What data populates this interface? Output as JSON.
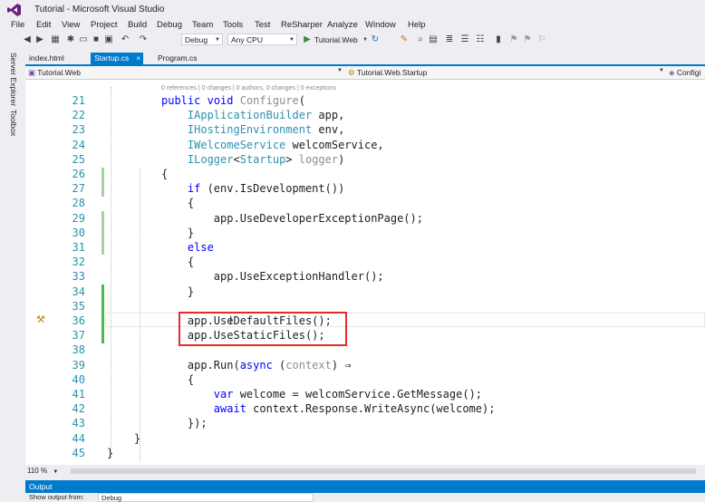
{
  "window": {
    "title": "Tutorial - Microsoft Visual Studio"
  },
  "menu": [
    "File",
    "Edit",
    "View",
    "Project",
    "Build",
    "Debug",
    "Team",
    "Tools",
    "Test",
    "ReSharper",
    "Analyze",
    "Window",
    "Help"
  ],
  "toolbar": {
    "config": "Debug",
    "platform": "Any CPU",
    "start_target": "Tutorial.Web"
  },
  "side_panels": [
    "Server Explorer",
    "Toolbox"
  ],
  "tabs": [
    {
      "label": "index.html",
      "active": false
    },
    {
      "label": "Startup.cs",
      "active": true
    },
    {
      "label": "Program.cs",
      "active": false
    }
  ],
  "nav": {
    "project": "Tutorial.Web",
    "type": "Tutorial.Web.Startup",
    "member": "Configi"
  },
  "code_lens": "0 references | 0 changes | 0 authors, 0 changes | 0 exceptions",
  "line_numbers": [
    "21",
    "22",
    "23",
    "24",
    "25",
    "26",
    "27",
    "28",
    "29",
    "30",
    "31",
    "32",
    "33",
    "34",
    "35",
    "36",
    "37",
    "38",
    "39",
    "40",
    "41",
    "42",
    "43",
    "44",
    "45"
  ],
  "code": {
    "l21": {
      "a": "public",
      "b": " ",
      "c": "void",
      "d": " Configure",
      "e": "("
    },
    "l22": {
      "a": "    IApplicationBuilder",
      "b": " app,"
    },
    "l23": {
      "a": "    IHostingEnvironment",
      "b": " env,"
    },
    "l24": {
      "a": "    IWelcomeService",
      "b": " welcomService,"
    },
    "l25": {
      "a": "    ILogger",
      "b": "<",
      "c": "Startup",
      "d": "> ",
      "e": "logger",
      "f": ")"
    },
    "l26": "{",
    "l27": {
      "a": "    if",
      "b": " (env.IsDevelopment())"
    },
    "l28": "    {",
    "l29": "        app.UseDeveloperExceptionPage();",
    "l30": "    }",
    "l31": "    else",
    "l32": "    {",
    "l33": "        app.UseExceptionHandler();",
    "l34": "    }",
    "l35": "",
    "l36": "    app.UseDefaultFiles();",
    "l37": "    app.UseStaticFiles();",
    "l38": "",
    "l39": {
      "a": "    app.Run(",
      "b": "async",
      "c": " (",
      "d": "context",
      "e": ") ⇒"
    },
    "l40": "    {",
    "l41": {
      "a": "        var",
      "b": " welcome = welcomService.GetMessage();"
    },
    "l42": {
      "a": "        await",
      "b": " context.Response.WriteAsync(welcome);"
    },
    "l43": "    });",
    "l44": "}",
    "l45": "}"
  },
  "zoom": "110 %",
  "output": {
    "title": "Output",
    "show_from_label": "Show output from:",
    "source": "Debug"
  }
}
